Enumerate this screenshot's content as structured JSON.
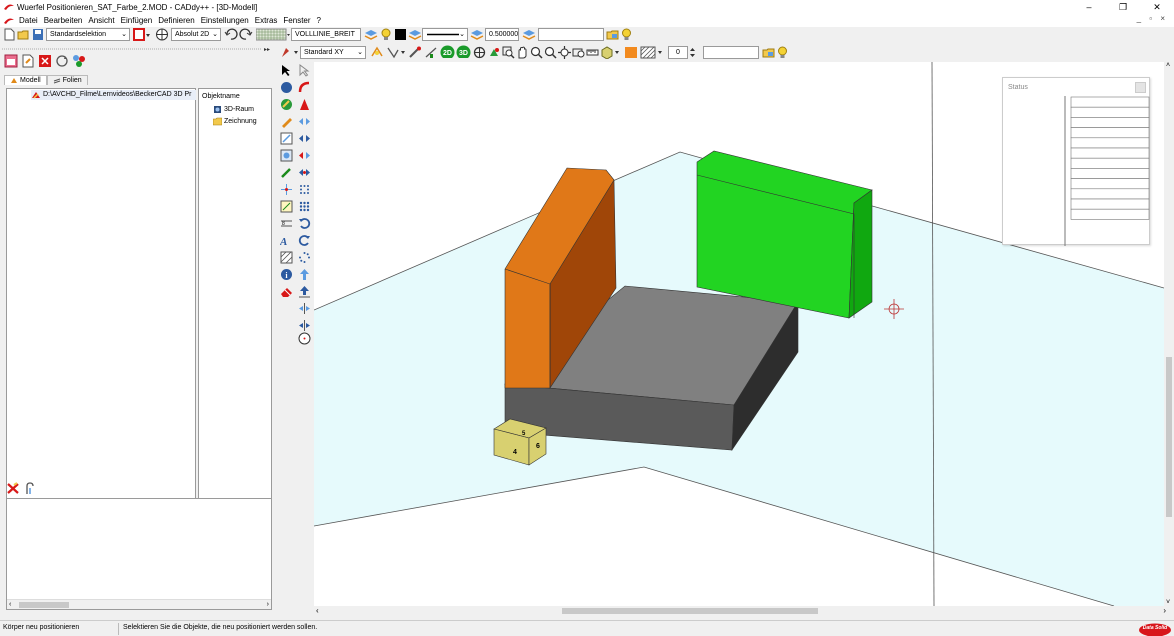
{
  "window": {
    "title": "Wuerfel Positionieren_SAT_Farbe_2.MOD  -  CADdy++ - [3D-Modell]",
    "controls": [
      "–",
      "❐",
      "✕"
    ],
    "mdi_controls": "_ ▫ ×",
    "app_icon": "caddy-logo-icon"
  },
  "menu": {
    "items": [
      "Datei",
      "Bearbeiten",
      "Ansicht",
      "Einfügen",
      "Definieren",
      "Einstellungen",
      "Extras",
      "Fenster",
      "?"
    ]
  },
  "toolbar1": {
    "selection_mode": "Standardselektion",
    "coord_mode": "Absolut 2D",
    "line_type": "VOLLLINIE_BREIT",
    "line_width": "0.500000",
    "free_field": ""
  },
  "toolbar2": {
    "view": "Standard XY",
    "layer_number": "0",
    "btn_2d": "2D",
    "btn_3d": "3D",
    "free_field": ""
  },
  "left_panel": {
    "tabs": [
      "Modell",
      "Folien"
    ],
    "tree_root": "D:\\AVCHD_Filme\\Lernvideos\\BeckerCAD 3D Pr",
    "name_header": "Objektname",
    "name_items": [
      "3D-Raum",
      "Zeichnung"
    ]
  },
  "viewport": {
    "cube_labels": [
      "4",
      "5",
      "6"
    ],
    "colors": {
      "floor": "#e6fafc",
      "base_top": "#808080",
      "base_front": "#5a5a5a",
      "base_side": "#2d2d2d",
      "orange_front": "#e07818",
      "orange_side": "#a04608",
      "green_front": "#22d422",
      "green_side": "#10a810",
      "cube": "#d8d070"
    }
  },
  "status_panel": {
    "title": "Status",
    "rows": 12
  },
  "statusbar": {
    "left": "Körper neu positionieren",
    "message": "Selektieren Sie die Objekte, die neu positioniert werden sollen.",
    "logo": "Data Solid"
  }
}
